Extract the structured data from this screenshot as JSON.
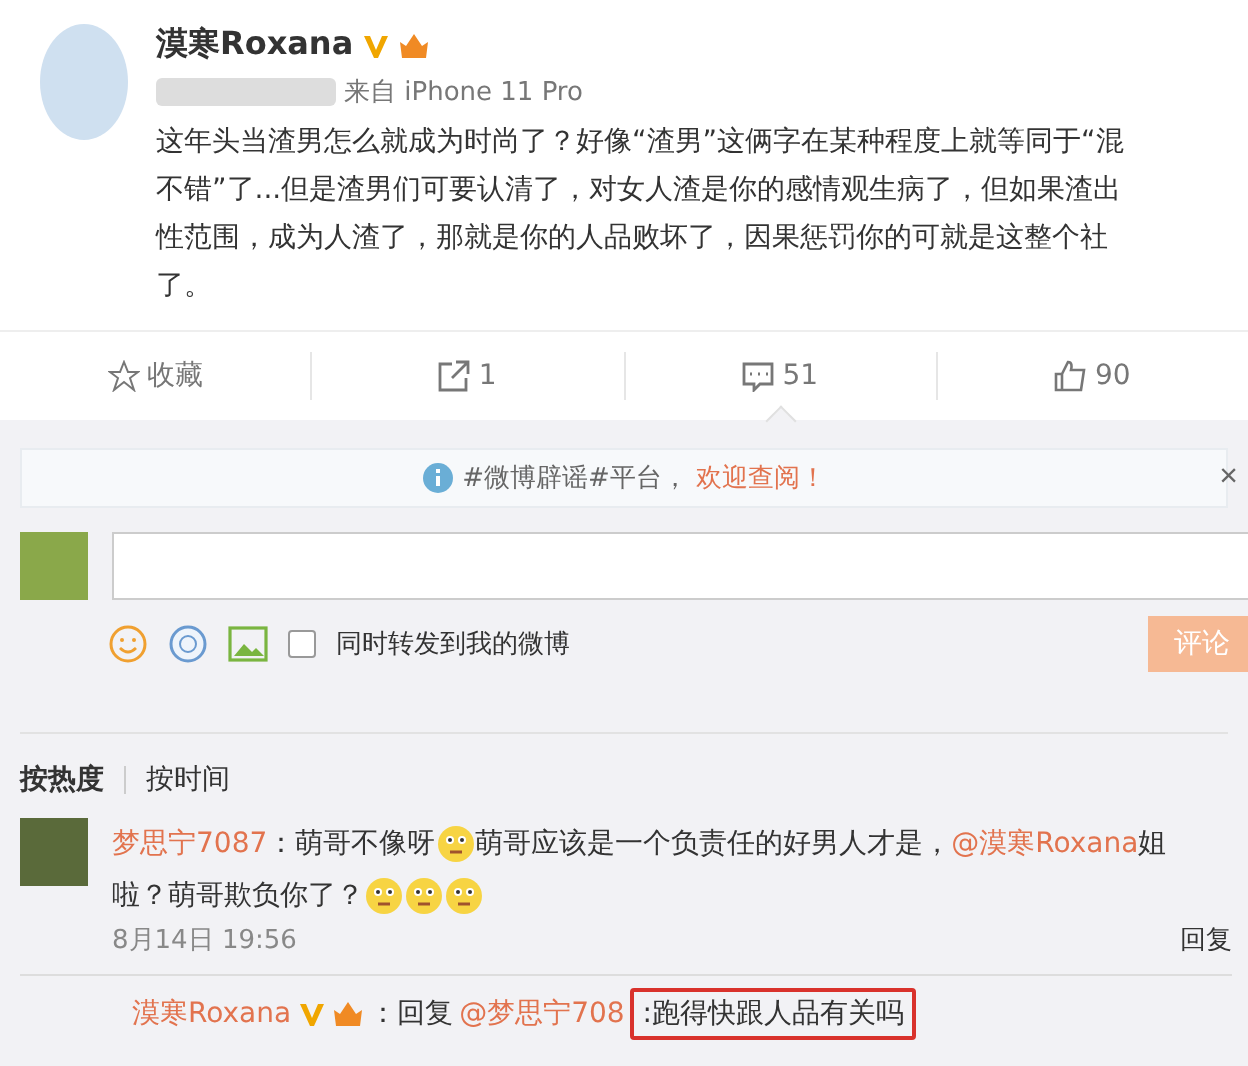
{
  "post": {
    "author": "漠寒Roxana",
    "source": "来自 iPhone 11 Pro",
    "lines": [
      "这年头当渣男怎么就成为时尚了？好像“渣男”这俩字在某种程度上就等同于“混",
      "不错”了...但是渣男们可要认清了，对女人渣是你的感情观生病了，但如果渣出",
      "性范围，成为人渣了，那就是你的人品败坏了，因果惩罚你的可就是这整个社",
      "了。"
    ]
  },
  "actions": [
    {
      "kind": "favorite",
      "label": "收藏",
      "selected": false
    },
    {
      "kind": "repost",
      "label": "1",
      "selected": false
    },
    {
      "kind": "comment",
      "label": "51",
      "selected": true
    },
    {
      "kind": "like",
      "label": "90",
      "selected": false
    }
  ],
  "notice": {
    "text": "#微博辟谣#平台，",
    "link": "欢迎查阅！",
    "close": "×"
  },
  "composer": {
    "repost_checked": false,
    "repost_label": "同时转发到我的微博",
    "submit": "评论"
  },
  "sort_tabs": [
    {
      "label": "按热度",
      "selected": true
    },
    {
      "label": "按时间",
      "selected": false
    }
  ],
  "comments": [
    {
      "author": "梦思宁7087",
      "lines": [
        [
          {
            "kind": "text",
            "text": "：萌哥不像呀"
          },
          {
            "kind": "emoji"
          },
          {
            "kind": "text",
            "text": "萌哥应该是一个负责任的好男人才是，"
          },
          {
            "kind": "mention",
            "text": "@漠寒Roxana"
          },
          {
            "kind": "text",
            "text": " 姐"
          }
        ],
        [
          {
            "kind": "text",
            "text": "啦？萌哥欺负你了？"
          },
          {
            "kind": "emoji"
          },
          {
            "kind": "emoji"
          },
          {
            "kind": "emoji"
          }
        ]
      ],
      "time": "8月14日 19:56",
      "reply_label": "回复",
      "reply": {
        "author": "漠寒Roxana",
        "prefix": "：回复",
        "mention": "@梦思宁708",
        "highlight": ":跑得快跟人品有关吗"
      }
    }
  ]
}
